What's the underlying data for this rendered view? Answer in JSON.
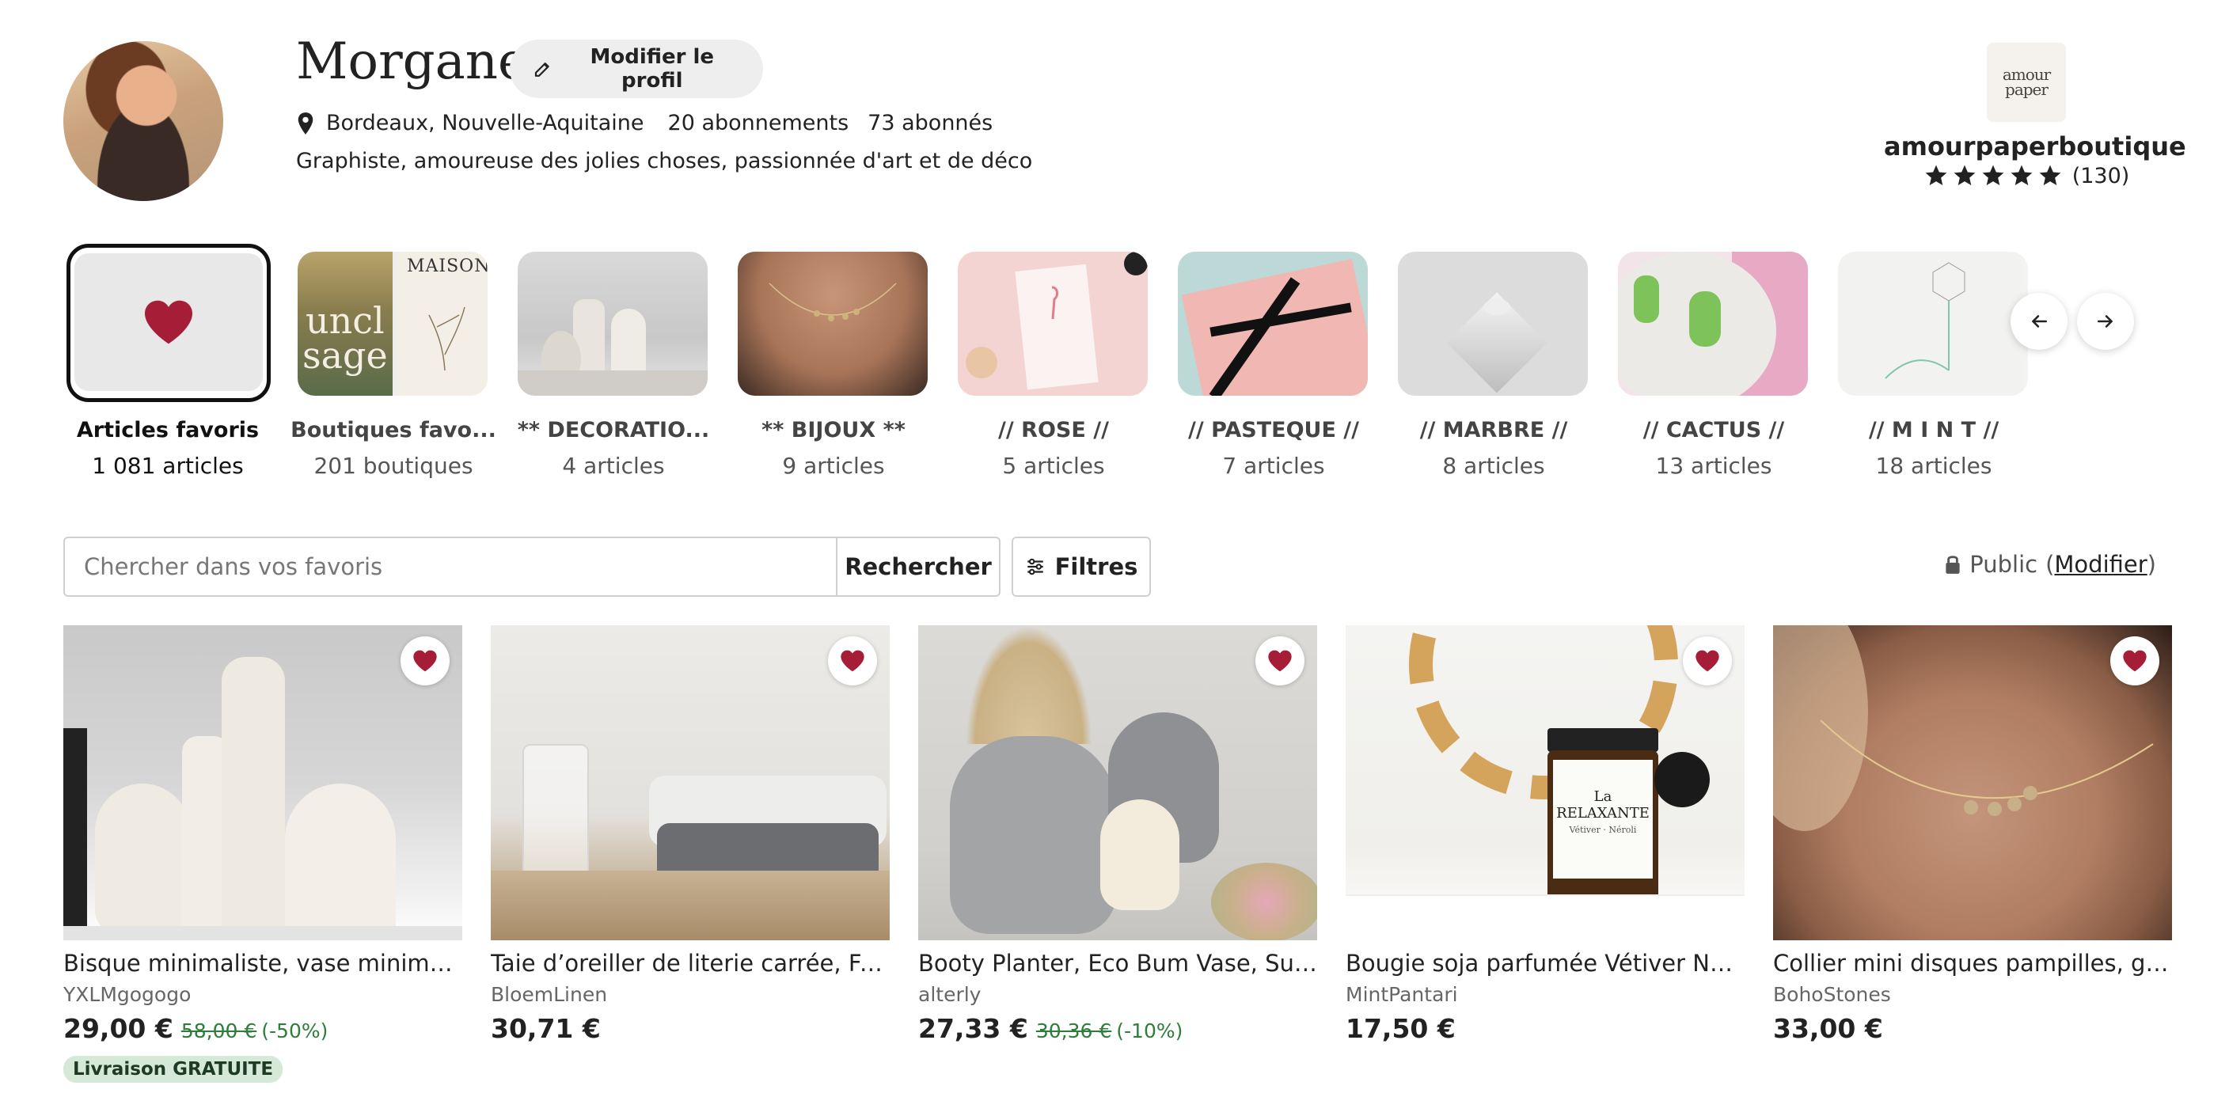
{
  "profile": {
    "name": "Morgane",
    "edit_label": "Modifier le profil",
    "location": "Bordeaux, Nouvelle-Aquitaine",
    "following": "20 abonnements",
    "followers": "73 abonnés",
    "bio": "Graphiste, amoureuse des jolies choses, passionnée d'art et de déco"
  },
  "shop": {
    "logo_line1": "amour",
    "logo_line2": "paper",
    "name": "amourpaperboutique",
    "rating_stars": 5,
    "review_count": "(130)"
  },
  "collections": [
    {
      "title": "Articles favoris",
      "count": "1 081 articles",
      "selected": true
    },
    {
      "title": "Boutiques favo...",
      "count": "201 boutiques"
    },
    {
      "title": "** DECORATIO...",
      "count": "4 articles"
    },
    {
      "title": "** BIJOUX **",
      "count": "9 articles"
    },
    {
      "title": "// ROSE //",
      "count": "5 articles"
    },
    {
      "title": "// PASTEQUE //",
      "count": "7 articles"
    },
    {
      "title": "// MARBRE //",
      "count": "8 articles"
    },
    {
      "title": "// CACTUS //",
      "count": "13 articles"
    },
    {
      "title": "// M I N T //",
      "count": "18 articles"
    }
  ],
  "collection_tile_text": {
    "tile2_word1": "uncl",
    "tile2_word2": "sage",
    "tile2_brand": "MAISON"
  },
  "search": {
    "placeholder": "Chercher dans vos favoris",
    "button_label": "Rechercher",
    "filter_label": "Filtres",
    "privacy_label": "Public",
    "privacy_open": "(",
    "privacy_link": "Modifier",
    "privacy_close": ")"
  },
  "products": [
    {
      "title": "Bisque minimaliste, vase minimaliste, vase en céramique",
      "shop": "YXLMgogogo",
      "price": "29,00 €",
      "original_price": "58,00 €",
      "discount": "(-50%)",
      "badge": "Livraison GRATUITE"
    },
    {
      "title": "Taie d’oreiller de literie carrée, Faite en lin lavé",
      "shop": "BloemLinen",
      "price": "30,71 €"
    },
    {
      "title": "Booty Planter, Eco Bum Vase, Succulent planter",
      "shop": "alterly",
      "price": "27,33 €",
      "original_price": "30,36 €",
      "discount": "(-10%)"
    },
    {
      "title": "Bougie soja parfumée Vétiver Néroli La Relaxante",
      "shop": "MintPantari",
      "price": "17,50 €",
      "label_text": "La RELAXANTE",
      "label_sub": "Vétiver · Néroli"
    },
    {
      "title": "Collier mini disques pampilles, gold filled",
      "shop": "BohoStones",
      "price": "33,00 €"
    }
  ],
  "colors": {
    "heart": "#a61d38",
    "discount_green": "#2e7d3a",
    "badge_bg": "#d4e9d7"
  }
}
